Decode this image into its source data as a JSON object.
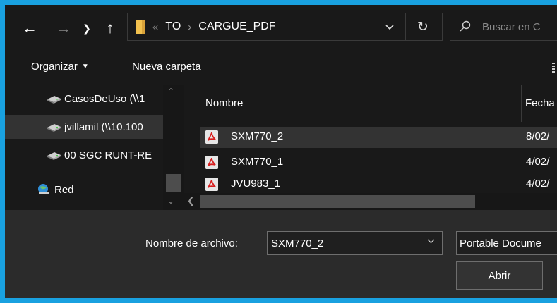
{
  "address_bar": {
    "back_icon": "arrow-left-icon",
    "forward_icon": "arrow-right-icon",
    "recent_icon": "chevron-down-icon",
    "up_icon": "arrow-up-icon",
    "overflow": "«",
    "crumbs": [
      "TO",
      "CARGUE_PDF"
    ],
    "separator": "›",
    "refresh_icon": "refresh-icon"
  },
  "search": {
    "placeholder": "Buscar en C"
  },
  "toolbar": {
    "organize_label": "Organizar",
    "new_folder_label": "Nueva carpeta"
  },
  "nav_pane": {
    "items": [
      {
        "label": "CasosDeUso (\\\\1",
        "icon": "network-drive-icon"
      },
      {
        "label": "jvillamil (\\\\10.100",
        "icon": "network-drive-icon",
        "selected": true
      },
      {
        "label": "00 SGC RUNT-RE",
        "icon": "network-drive-icon"
      },
      {
        "label": "Red",
        "icon": "network-icon"
      }
    ]
  },
  "file_list": {
    "columns": [
      "Nombre",
      "Fecha"
    ],
    "rows": [
      {
        "name": "SXM770_2",
        "date": "8/02/",
        "icon": "pdf-icon",
        "selected": true
      },
      {
        "name": "SXM770_1",
        "date": "4/02/",
        "icon": "pdf-icon"
      },
      {
        "name": "JVU983_1",
        "date": "4/02/",
        "icon": "pdf-icon"
      }
    ]
  },
  "footer": {
    "filename_label": "Nombre de archivo:",
    "filename_value": "SXM770_2",
    "file_type": "Portable Docume",
    "open_label": "Abrir"
  },
  "colors": {
    "window_border": "#19a1e0",
    "background": "#191919",
    "selection": "#333333",
    "bottom_pane": "#2b2b2b",
    "pdf_red": "#d81e1e",
    "folder_yellow": "#f2c14e"
  }
}
